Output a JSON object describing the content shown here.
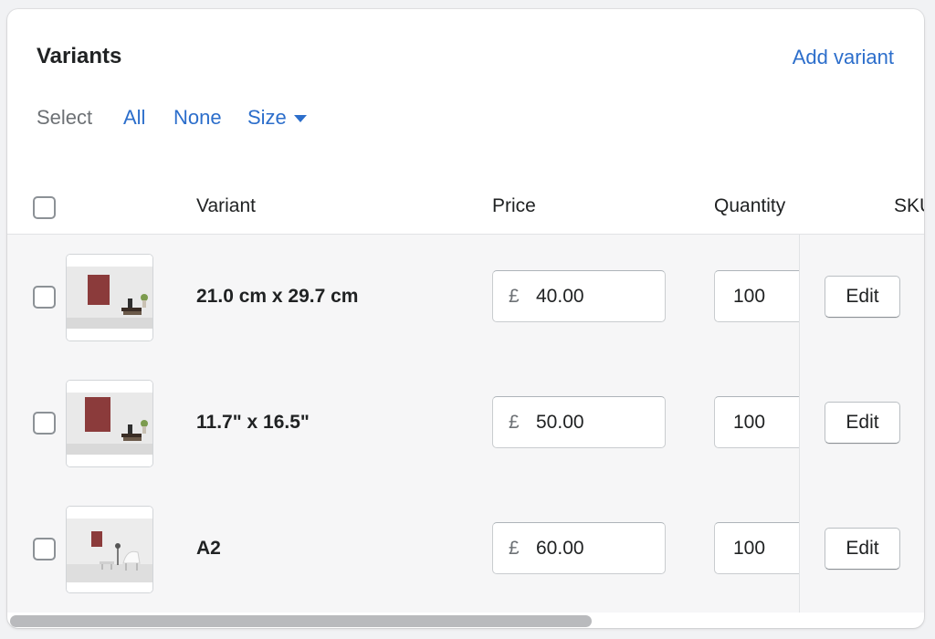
{
  "card": {
    "title": "Variants",
    "add_variant_label": "Add variant"
  },
  "select_bar": {
    "label": "Select",
    "all_label": "All",
    "none_label": "None",
    "size_label": "Size"
  },
  "table": {
    "columns": [
      "Variant",
      "Price",
      "Quantity",
      "SKU"
    ],
    "rows": [
      {
        "variant": "21.0 cm x 29.7 cm",
        "currency": "£",
        "price": "40.00",
        "quantity": "100",
        "action": "Edit",
        "thumbnail": "poster-on-shelf"
      },
      {
        "variant": "11.7\" x 16.5\"",
        "currency": "£",
        "price": "50.00",
        "quantity": "100",
        "action": "Edit",
        "thumbnail": "poster-on-shelf"
      },
      {
        "variant": "A2",
        "currency": "£",
        "price": "60.00",
        "quantity": "100",
        "action": "Edit",
        "thumbnail": "poster-in-room"
      }
    ]
  },
  "colors": {
    "link": "#2c6ecb",
    "row_background": "#f6f6f7",
    "poster": "#8b3b3b"
  }
}
